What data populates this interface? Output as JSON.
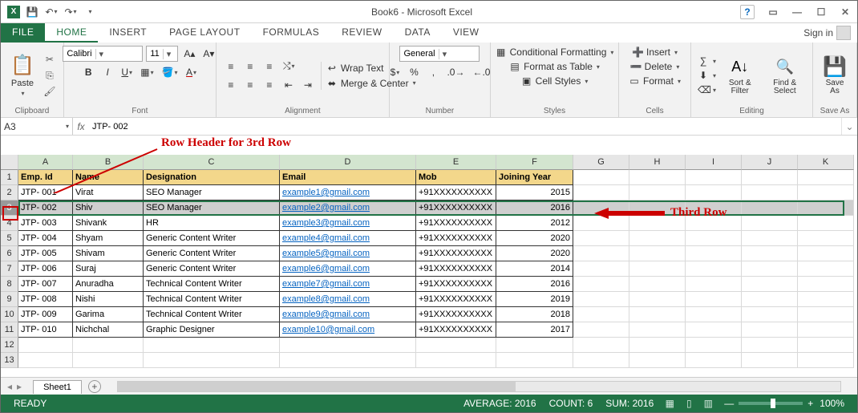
{
  "title": "Book6 - Microsoft Excel",
  "tabs": {
    "file": "FILE",
    "home": "HOME",
    "insert": "INSERT",
    "pagelayout": "PAGE LAYOUT",
    "formulas": "FORMULAS",
    "review": "REVIEW",
    "data": "DATA",
    "view": "VIEW"
  },
  "signin": "Sign in",
  "ribbon": {
    "clipboard": {
      "label": "Clipboard",
      "paste": "Paste"
    },
    "font": {
      "label": "Font",
      "name": "Calibri",
      "size": "11"
    },
    "alignment": {
      "label": "Alignment",
      "wrap": "Wrap Text",
      "merge": "Merge & Center"
    },
    "number": {
      "label": "Number",
      "format": "General"
    },
    "styles": {
      "label": "Styles",
      "cond": "Conditional Formatting",
      "fat": "Format as Table",
      "cell": "Cell Styles"
    },
    "cells": {
      "label": "Cells",
      "insert": "Insert",
      "delete": "Delete",
      "format": "Format"
    },
    "editing": {
      "label": "Editing",
      "sort": "Sort & Filter",
      "find": "Find & Select"
    },
    "saveas": {
      "label": "Save As",
      "btn": "Save As"
    }
  },
  "namebox": "A3",
  "formula": "JTP- 002",
  "annotations": {
    "rowHeader": "Row Header for 3rd Row",
    "thirdRow": "Third Row"
  },
  "columns": [
    "A",
    "B",
    "C",
    "D",
    "E",
    "F",
    "G",
    "H",
    "I",
    "J",
    "K"
  ],
  "headers": {
    "a": "Emp. Id",
    "b": "Name",
    "c": "Designation",
    "d": "Email",
    "e": "Mob",
    "f": "Joining Year"
  },
  "rows": [
    {
      "n": "2",
      "a": "JTP- 001",
      "b": "Virat",
      "c": "SEO Manager",
      "d": "example1@gmail.com",
      "e": "+91XXXXXXXXXX",
      "f": "2015"
    },
    {
      "n": "3",
      "a": "JTP- 002",
      "b": "Shiv",
      "c": "SEO Manager",
      "d": "example2@gmail.com",
      "e": "+91XXXXXXXXXX",
      "f": "2016"
    },
    {
      "n": "4",
      "a": "JTP- 003",
      "b": "Shivank",
      "c": "HR",
      "d": "example3@gmail.com",
      "e": "+91XXXXXXXXXX",
      "f": "2012"
    },
    {
      "n": "5",
      "a": "JTP- 004",
      "b": "Shyam",
      "c": "Generic Content Writer",
      "d": "example4@gmail.com",
      "e": "+91XXXXXXXXXX",
      "f": "2020"
    },
    {
      "n": "6",
      "a": "JTP- 005",
      "b": "Shivam",
      "c": "Generic Content Writer",
      "d": "example5@gmail.com",
      "e": "+91XXXXXXXXXX",
      "f": "2020"
    },
    {
      "n": "7",
      "a": "JTP- 006",
      "b": "Suraj",
      "c": "Generic Content Writer",
      "d": "example6@gmail.com",
      "e": "+91XXXXXXXXXX",
      "f": "2014"
    },
    {
      "n": "8",
      "a": "JTP- 007",
      "b": "Anuradha",
      "c": "Technical Content Writer",
      "d": "example7@gmail.com",
      "e": "+91XXXXXXXXXX",
      "f": "2016"
    },
    {
      "n": "9",
      "a": "JTP- 008",
      "b": "Nishi",
      "c": "Technical Content Writer",
      "d": "example8@gmail.com",
      "e": "+91XXXXXXXXXX",
      "f": "2019"
    },
    {
      "n": "10",
      "a": "JTP- 009",
      "b": "Garima",
      "c": "Technical Content Writer",
      "d": "example9@gmail.com",
      "e": "+91XXXXXXXXXX",
      "f": "2018"
    },
    {
      "n": "11",
      "a": "JTP- 010",
      "b": "Nichchal",
      "c": "Graphic Designer",
      "d": "example10@gmail.com",
      "e": "+91XXXXXXXXXX",
      "f": "2017"
    }
  ],
  "emptyRows": [
    "12",
    "13"
  ],
  "sheet": "Sheet1",
  "status": {
    "ready": "READY",
    "avg": "AVERAGE: 2016",
    "count": "COUNT: 6",
    "sum": "SUM: 2016",
    "zoom": "100%"
  }
}
